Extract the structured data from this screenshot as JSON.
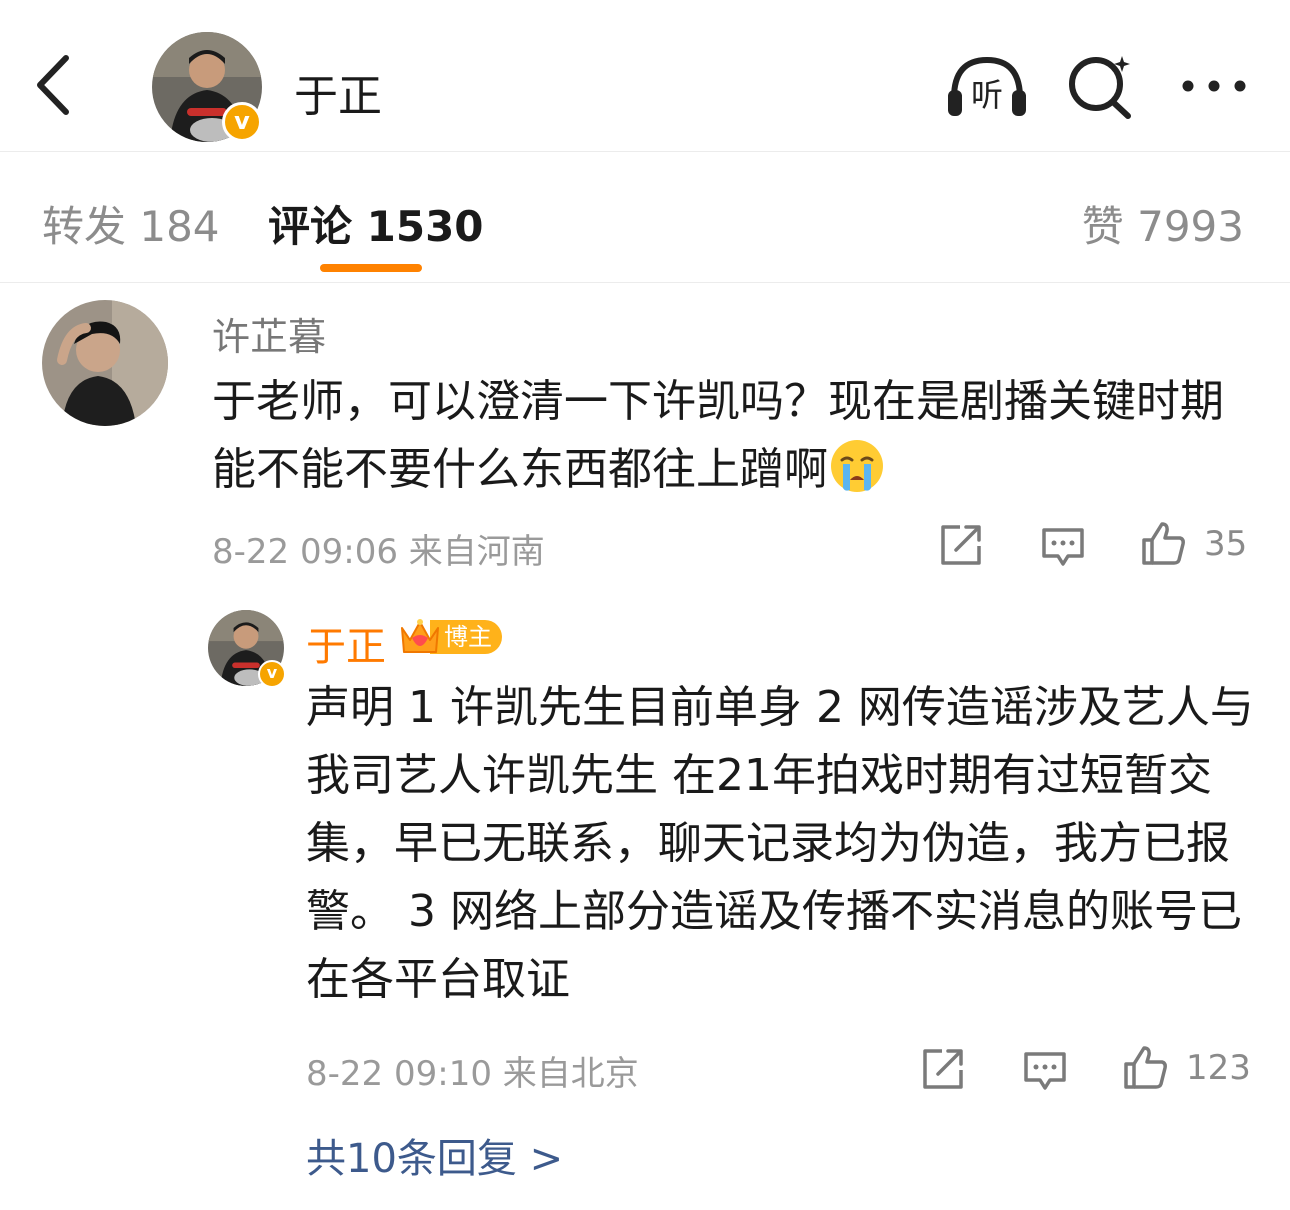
{
  "header": {
    "title": "于正",
    "listen_label": "听",
    "verified_mark": "v"
  },
  "tabs": {
    "repost": "转发 184",
    "comments": "评论 1530",
    "likes": "赞 7993"
  },
  "colors": {
    "accent": "#ff8200",
    "verified": "#f6a400",
    "link": "#3d5a8c"
  },
  "comment": {
    "user": "许芷暮",
    "text": "于老师，可以澄清一下许凯吗？现在是剧播关键时期能不能不要什么东西都往上蹭啊",
    "emoji": "crying-face",
    "meta": "8-22 09:06 来自河南",
    "like_count": "35"
  },
  "reply": {
    "user": "于正",
    "badge": "博主",
    "verified_mark": "v",
    "text": "声明 1 许凯先生目前单身 2 网传造谣涉及艺人与我司艺人许凯先生 在21年拍戏时期有过短暂交集，早已无联系，聊天记录均为伪造，我方已报警。 3 网络上部分造谣及传播不实消息的账号已在各平台取证",
    "meta": "8-22 09:10 来自北京",
    "like_count": "123",
    "more_replies": "共10条回复 >"
  }
}
